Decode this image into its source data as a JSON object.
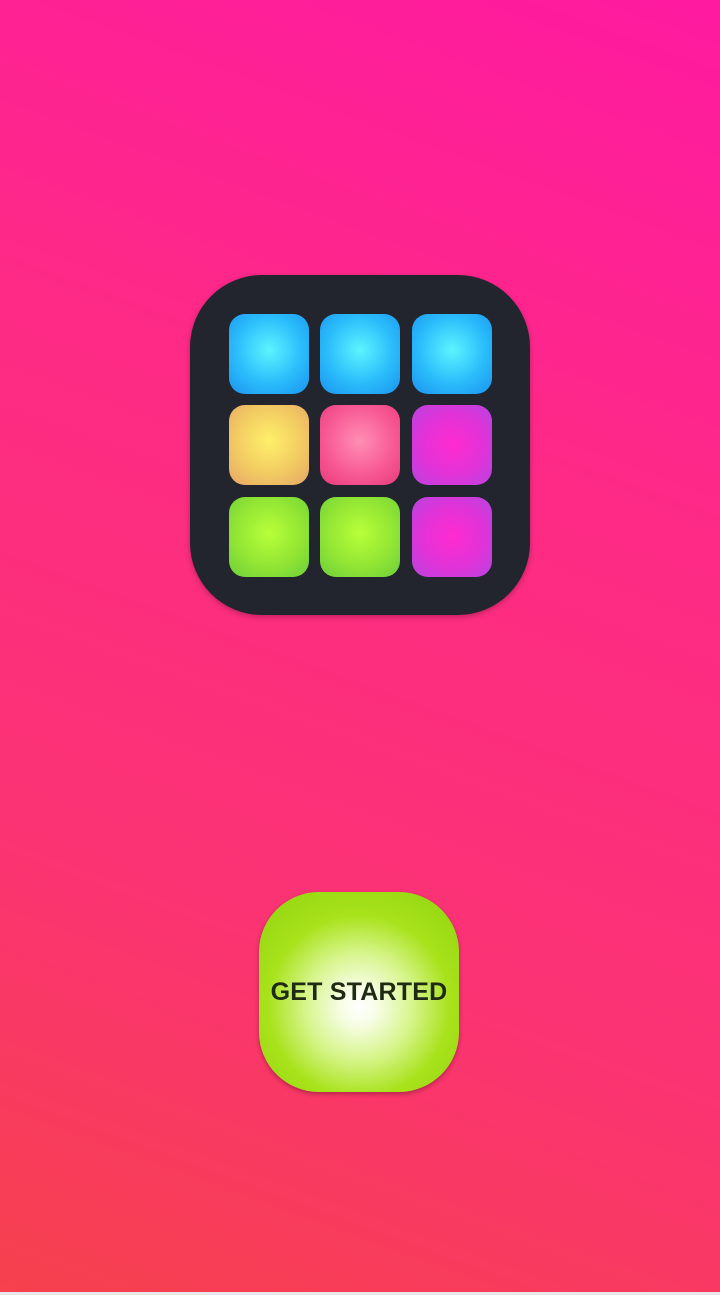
{
  "logo": {
    "icon": "drum-pad-grid-icon",
    "background_color": "#23252e",
    "pads": [
      {
        "color": "cyan"
      },
      {
        "color": "cyan"
      },
      {
        "color": "cyan"
      },
      {
        "color": "yellow"
      },
      {
        "color": "pink"
      },
      {
        "color": "magenta"
      },
      {
        "color": "green"
      },
      {
        "color": "green"
      },
      {
        "color": "magenta"
      }
    ]
  },
  "get_started": {
    "label": "GET STARTED",
    "color": "#8ed40e"
  },
  "background": {
    "gradient_top": "#ff1aa0",
    "gradient_bottom": "#f6414d"
  }
}
